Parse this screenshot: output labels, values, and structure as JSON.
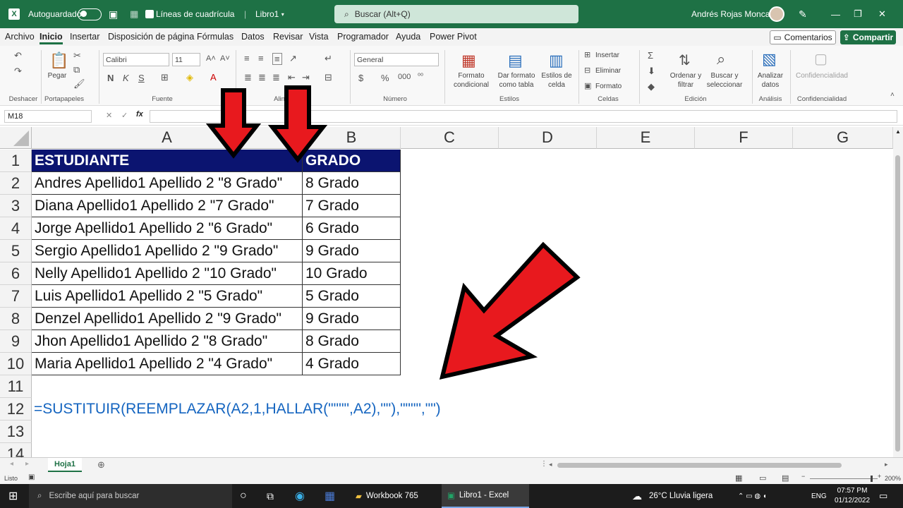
{
  "titlebar": {
    "autosave_label": "Autoguardado",
    "gridlines_label": "Líneas de cuadrícula",
    "doc_name": "Libro1",
    "search_placeholder": "Buscar (Alt+Q)",
    "user_name": "Andrés Rojas Moncada"
  },
  "menu": {
    "tabs": [
      "Archivo",
      "Inicio",
      "Insertar",
      "Disposición de página",
      "Fórmulas",
      "Datos",
      "Revisar",
      "Vista",
      "Programador",
      "Ayuda",
      "Power Pivot"
    ],
    "comments_label": "Comentarios",
    "share_label": "Compartir"
  },
  "ribbon": {
    "undo_group": "Deshacer",
    "clipboard": {
      "paste": "Pegar",
      "group": "Portapapeles"
    },
    "font": {
      "name": "Calibri",
      "size": "11",
      "group": "Fuente",
      "bold": "N",
      "italic": "K",
      "underline": "S"
    },
    "alignment_group": "Alin",
    "number": {
      "format": "General",
      "group": "Número",
      "currency": "$",
      "percent": "%"
    },
    "styles": {
      "conditional": "Formato condicional",
      "table": "Dar formato como tabla",
      "cell": "Estilos de celda",
      "group": "Estilos"
    },
    "cells": {
      "insert": "Insertar",
      "delete": "Eliminar",
      "format": "Formato",
      "group": "Celdas"
    },
    "editing": {
      "sort": "Ordenar y filtrar",
      "find": "Buscar y seleccionar",
      "group": "Edición"
    },
    "analysis": {
      "analyze": "Analizar datos",
      "group": "Análisis"
    },
    "confidentiality": {
      "label": "Confidencialidad",
      "group": "Confidencialidad"
    }
  },
  "formula_bar": {
    "name_box": "M18",
    "fx": "fx",
    "content": ""
  },
  "grid": {
    "columns": [
      "A",
      "B",
      "C",
      "D",
      "E",
      "F",
      "G"
    ],
    "rows": [
      "1",
      "2",
      "3",
      "4",
      "5",
      "6",
      "7",
      "8",
      "9",
      "10",
      "11",
      "12",
      "13",
      "14"
    ],
    "header": [
      "ESTUDIANTE",
      "GRADO"
    ],
    "data": [
      [
        "Andres Apellido1 Apellido 2 \"8 Grado\"",
        "8 Grado"
      ],
      [
        "Diana Apellido1 Apellido 2 \"7 Grado\"",
        "7 Grado"
      ],
      [
        "Jorge Apellido1 Apellido 2 \"6 Grado\"",
        "6 Grado"
      ],
      [
        "Sergio Apellido1 Apellido 2 \"9 Grado\"",
        "9 Grado"
      ],
      [
        "Nelly Apellido1 Apellido 2 \"10 Grado\"",
        "10 Grado"
      ],
      [
        "Luis Apellido1 Apellido 2 \"5 Grado\"",
        "5 Grado"
      ],
      [
        "Denzel Apellido1 Apellido 2 \"9 Grado\"",
        "9 Grado"
      ],
      [
        "Jhon Apellido1 Apellido 2 \"8 Grado\"",
        "8 Grado"
      ],
      [
        "Maria Apellido1 Apellido 2 \"4 Grado\"",
        "4 Grado"
      ]
    ],
    "formula_text": "=SUSTITUIR(REEMPLAZAR(A2,1,HALLAR(\"\"\"\",A2),\"\"),\"\"\"\",\"\")"
  },
  "sheets": {
    "active": "Hoja1"
  },
  "status": {
    "ready": "Listo",
    "zoom": "200%"
  },
  "taskbar": {
    "search_placeholder": "Escribe aquí para buscar",
    "apps": [
      "Workbook 765",
      "Libro1 - Excel"
    ],
    "weather": "26°C  Lluvia ligera",
    "lang": "ENG",
    "time": "07:57 PM",
    "date": "01/12/2022"
  },
  "colors": {
    "excel_green": "#1e7145",
    "header_fill": "#0b1470",
    "formula_blue": "#1565c0",
    "arrow_red": "#e8191e"
  },
  "icons": [
    "excel-logo-icon",
    "save-icon",
    "search-icon",
    "pen-icon",
    "red-arrow-icon"
  ]
}
